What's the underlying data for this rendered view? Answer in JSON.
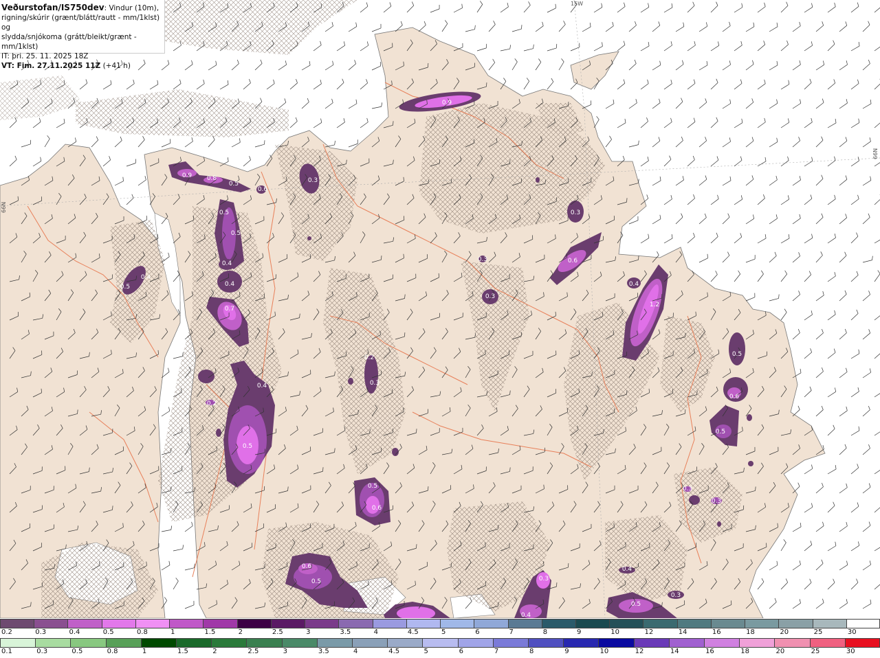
{
  "header": {
    "title_bold": "Veðurstofan/IS750dev",
    "title_rest": ": Vindur (10m),",
    "line2": "rigning/skúrir (grænt/blátt/rautt - mm/1klst) og",
    "line3": "slydda/snjókoma (grátt/bleikt/grænt - mm/1klst)",
    "it": "IT: þri. 25. 11. 2025 18Z",
    "vt_bold": "VT: Fim. 27.11.2025 11Z",
    "vt_rest": " (+41 h)"
  },
  "grid_labels": {
    "lon_top": "15W",
    "lat_left": "66N",
    "lat_right": "66N"
  },
  "colors": {
    "land": "#f1e2d3",
    "sea": "#ffffff",
    "roads": "#e8805a",
    "precip_dark": "#6a3d6e",
    "precip_mid": "#a050b0",
    "precip_light": "#e070e8",
    "precip_core": "#f4a8f6"
  },
  "precip_labels": [
    {
      "text": "0.9"
    },
    {
      "text": "0.9"
    },
    {
      "text": "0.8"
    },
    {
      "text": "0.5"
    },
    {
      "text": "0.6"
    },
    {
      "text": "0.3"
    },
    {
      "text": "0.5"
    },
    {
      "text": "0.5"
    },
    {
      "text": "0.4"
    },
    {
      "text": "0.4"
    },
    {
      "text": "0.7"
    },
    {
      "text": "0.5"
    },
    {
      "text": "0.4"
    },
    {
      "text": "0.3"
    },
    {
      "text": "0.6"
    },
    {
      "text": "0.3"
    },
    {
      "text": "0.3"
    },
    {
      "text": "0.4"
    },
    {
      "text": "1.2"
    },
    {
      "text": "0.5"
    },
    {
      "text": "0.6"
    },
    {
      "text": "0.5"
    },
    {
      "text": "0.2"
    },
    {
      "text": "0.3"
    },
    {
      "text": "0.4"
    },
    {
      "text": "0.2"
    },
    {
      "text": "0.5"
    },
    {
      "text": "0.5"
    },
    {
      "text": "0.6"
    },
    {
      "text": "0.3"
    },
    {
      "text": "0.3"
    },
    {
      "text": "0.6"
    },
    {
      "text": "0.5"
    },
    {
      "text": "0.4"
    },
    {
      "text": "0.5"
    },
    {
      "text": "0.3"
    },
    {
      "text": "0.3"
    },
    {
      "text": "0.4"
    }
  ],
  "legend_snow": [
    {
      "label": "0.2",
      "color": "#6e4a70"
    },
    {
      "label": "0.3",
      "color": "#8a4f90"
    },
    {
      "label": "0.4",
      "color": "#c060c8"
    },
    {
      "label": "0.5",
      "color": "#e278ea"
    },
    {
      "label": "0.8",
      "color": "#f090f4"
    },
    {
      "label": "1",
      "color": "#c058c8"
    },
    {
      "label": "1.5",
      "color": "#a038a8"
    },
    {
      "label": "2",
      "color": "#3c0044"
    },
    {
      "label": "2.5",
      "color": "#5a1a64"
    },
    {
      "label": "3",
      "color": "#7a3a8a"
    },
    {
      "label": "3.5",
      "color": "#8a6ab0"
    },
    {
      "label": "4",
      "color": "#9a9ae0"
    },
    {
      "label": "4.5",
      "color": "#b0b8f0"
    },
    {
      "label": "5",
      "color": "#a0b8e8"
    },
    {
      "label": "6",
      "color": "#90a8d8"
    },
    {
      "label": "7",
      "color": "#5a7a94"
    },
    {
      "label": "8",
      "color": "#2a5a6a"
    },
    {
      "label": "9",
      "color": "#1a4a50"
    },
    {
      "label": "10",
      "color": "#245058"
    },
    {
      "label": "12",
      "color": "#3a6a70"
    },
    {
      "label": "14",
      "color": "#507a80"
    },
    {
      "label": "16",
      "color": "#6a8a90"
    },
    {
      "label": "18",
      "color": "#7a9aa0"
    },
    {
      "label": "20",
      "color": "#8aa0a6"
    },
    {
      "label": "25",
      "color": "#a8b8bc"
    },
    {
      "label": "30",
      "color": "#ffffff"
    }
  ],
  "legend_rain": [
    {
      "label": "0.1",
      "color": "#d8f4d8"
    },
    {
      "label": "0.3",
      "color": "#a8dca0"
    },
    {
      "label": "0.5",
      "color": "#88c880"
    },
    {
      "label": "0.8",
      "color": "#58a058"
    },
    {
      "label": "1",
      "color": "#004a00"
    },
    {
      "label": "1.5",
      "color": "#1a6a2a"
    },
    {
      "label": "2",
      "color": "#2a7a3a"
    },
    {
      "label": "2.5",
      "color": "#3a8050"
    },
    {
      "label": "3",
      "color": "#4a8a68"
    },
    {
      "label": "3.5",
      "color": "#7a9aa8"
    },
    {
      "label": "4",
      "color": "#8aa0b8"
    },
    {
      "label": "4.5",
      "color": "#9aaac8"
    },
    {
      "label": "5",
      "color": "#b8bcf0"
    },
    {
      "label": "6",
      "color": "#a0a4e8"
    },
    {
      "label": "7",
      "color": "#7a7ad8"
    },
    {
      "label": "8",
      "color": "#5050c0"
    },
    {
      "label": "9",
      "color": "#2828b0"
    },
    {
      "label": "10",
      "color": "#0a0aa0"
    },
    {
      "label": "12",
      "color": "#6a3ab8"
    },
    {
      "label": "14",
      "color": "#a060d0"
    },
    {
      "label": "16",
      "color": "#d080e0"
    },
    {
      "label": "18",
      "color": "#f0a0d8"
    },
    {
      "label": "20",
      "color": "#f090b0"
    },
    {
      "label": "25",
      "color": "#f06080"
    },
    {
      "label": "30",
      "color": "#e81020"
    }
  ]
}
